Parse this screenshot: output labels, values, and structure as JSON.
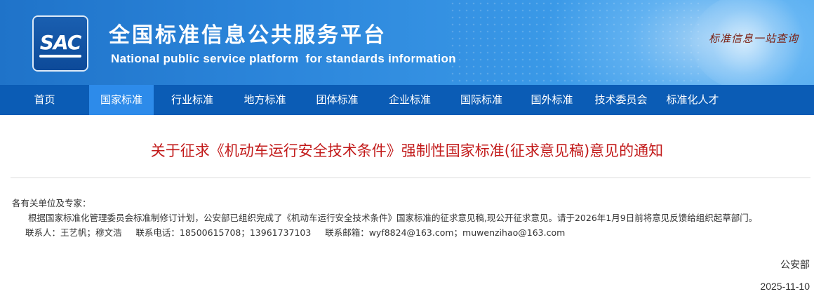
{
  "header": {
    "logo_text": "SAC",
    "title": "全国标准信息公共服务平台",
    "subtitle": "National public service platform  for standards information",
    "slogan": "标准信息一站查询"
  },
  "nav": {
    "items": [
      {
        "label": "首页",
        "active": false
      },
      {
        "label": "国家标准",
        "active": true
      },
      {
        "label": "行业标准",
        "active": false
      },
      {
        "label": "地方标准",
        "active": false
      },
      {
        "label": "团体标准",
        "active": false
      },
      {
        "label": "企业标准",
        "active": false
      },
      {
        "label": "国际标准",
        "active": false
      },
      {
        "label": "国外标准",
        "active": false
      },
      {
        "label": "技术委员会",
        "active": false
      },
      {
        "label": "标准化人才",
        "active": false
      }
    ]
  },
  "notice": {
    "title": "关于征求《机动车运行安全技术条件》强制性国家标准(征求意见稿)意见的通知",
    "salutation": "各有关单位及专家：",
    "body": "根据国家标准化管理委员会标准制修订计划，公安部已组织完成了《机动车运行安全技术条件》国家标准的征求意见稿,现公开征求意见。请于2026年1月9日前将意见反馈给组织起草部门。",
    "contact": "联系人：王艺帆；穆文浩     联系电话：18500615708；13961737103     联系邮箱：wyf8824@163.com；muwenzihao@163.com",
    "issuer": "公安部",
    "date": "2025-11-10"
  },
  "colors": {
    "header_blue": "#2c86db",
    "nav_blue": "#0b5cb5",
    "nav_active": "#2d8bea",
    "title_red": "#c21a1a"
  }
}
